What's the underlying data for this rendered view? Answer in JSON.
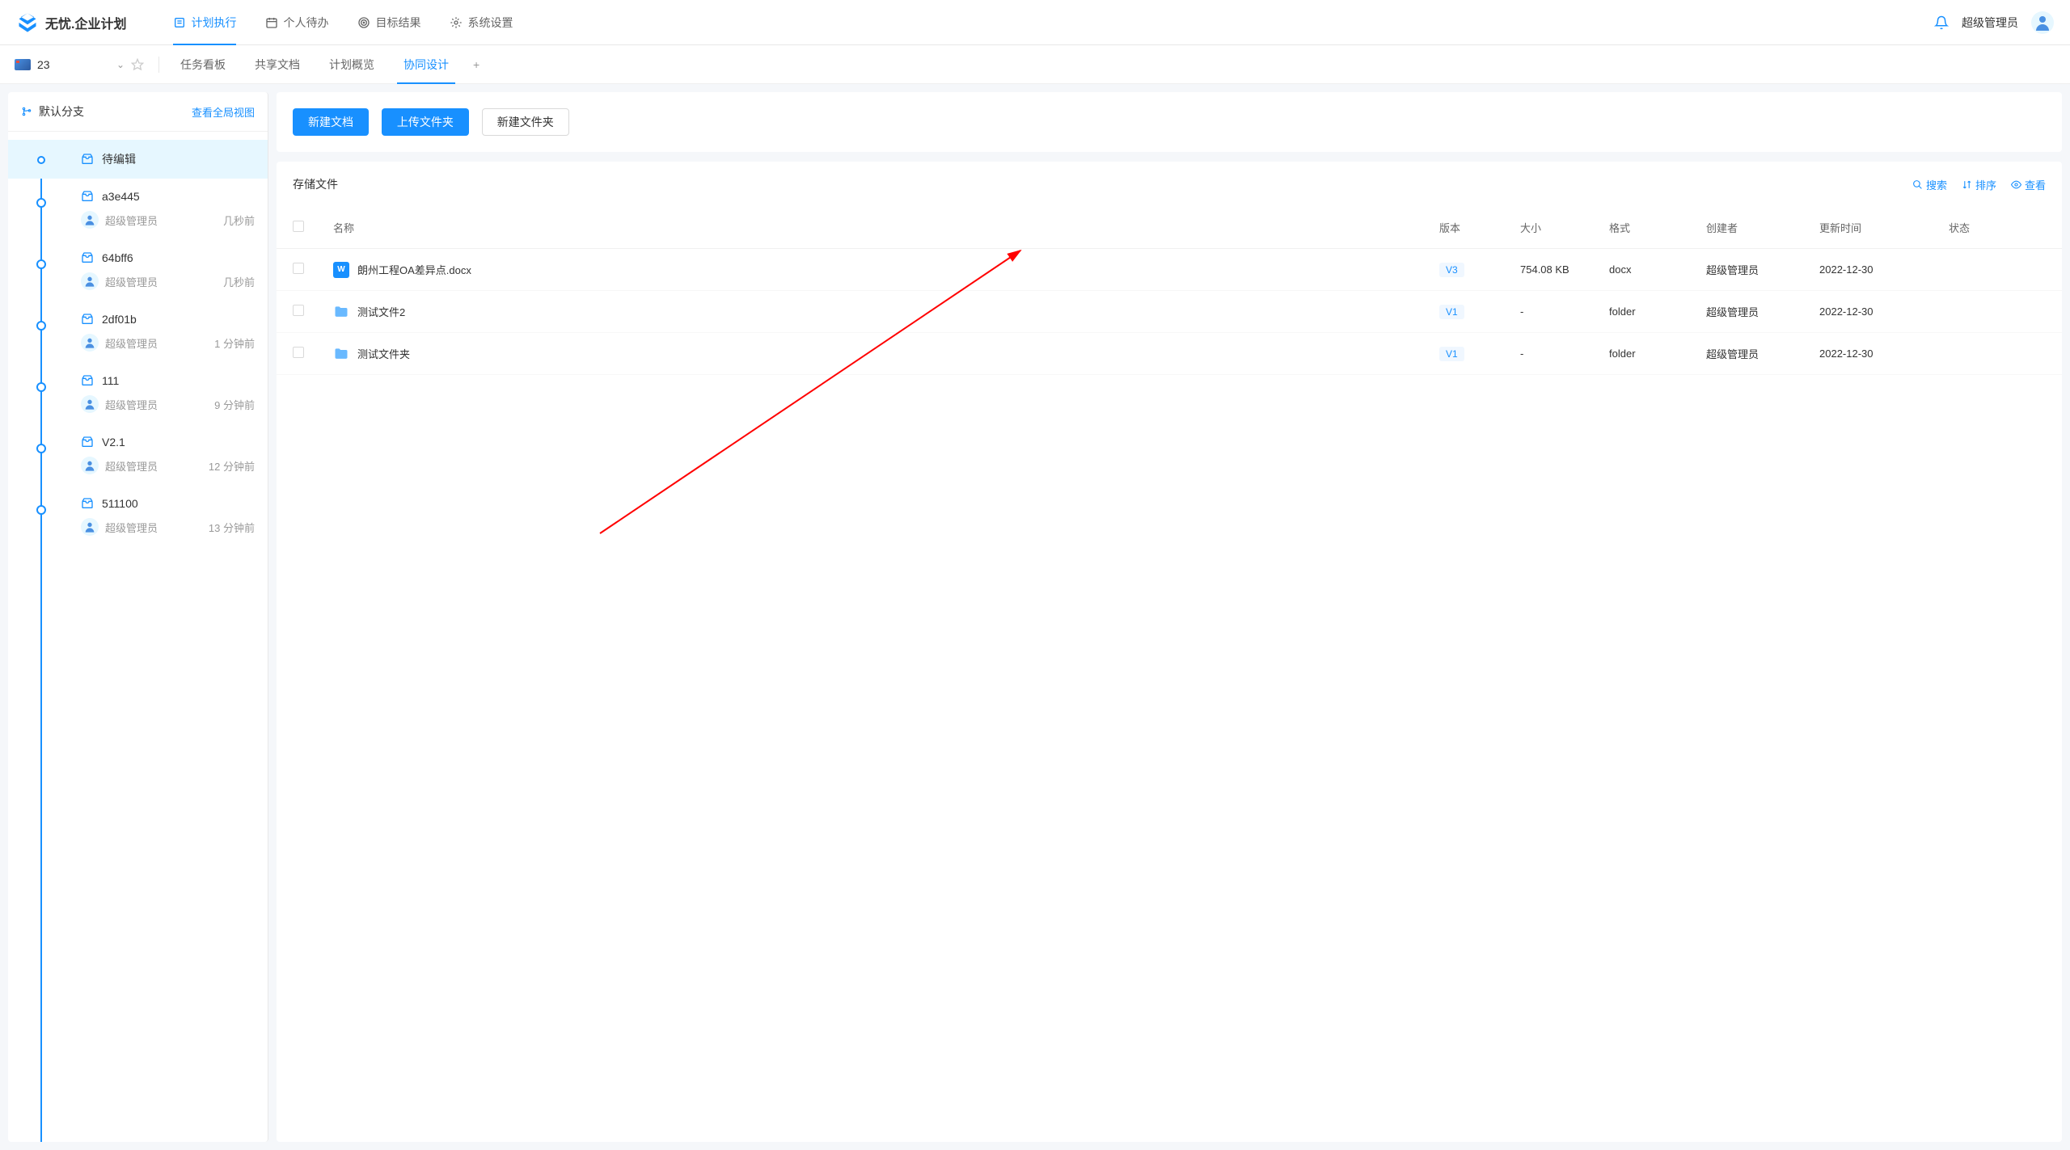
{
  "app": {
    "name": "无忧.企业计划"
  },
  "nav": [
    {
      "label": "计划执行",
      "icon": "plan",
      "active": true
    },
    {
      "label": "个人待办",
      "icon": "todo",
      "active": false
    },
    {
      "label": "目标结果",
      "icon": "target",
      "active": false
    },
    {
      "label": "系统设置",
      "icon": "settings",
      "active": false
    }
  ],
  "user": {
    "name": "超级管理员"
  },
  "project": {
    "name": "23"
  },
  "tabs": [
    {
      "label": "任务看板",
      "active": false
    },
    {
      "label": "共享文档",
      "active": false
    },
    {
      "label": "计划概览",
      "active": false
    },
    {
      "label": "协同设计",
      "active": true
    }
  ],
  "branch": {
    "name": "默认分支",
    "view_link": "查看全局视图"
  },
  "timeline": [
    {
      "title": "待编辑",
      "user": "",
      "time": "",
      "active": true,
      "first": true
    },
    {
      "title": "a3e445",
      "user": "超级管理员",
      "time": "几秒前"
    },
    {
      "title": "64bff6",
      "user": "超级管理员",
      "time": "几秒前"
    },
    {
      "title": "2df01b",
      "user": "超级管理员",
      "time": "1 分钟前"
    },
    {
      "title": "111",
      "user": "超级管理员",
      "time": "9 分钟前"
    },
    {
      "title": "V2.1",
      "user": "超级管理员",
      "time": "12 分钟前"
    },
    {
      "title": "511100",
      "user": "超级管理员",
      "time": "13 分钟前"
    }
  ],
  "actions": {
    "new_doc": "新建文档",
    "upload_folder": "上传文件夹",
    "new_folder": "新建文件夹"
  },
  "files_section": {
    "title": "存储文件",
    "tools": {
      "search": "搜索",
      "sort": "排序",
      "view": "查看"
    }
  },
  "table": {
    "headers": {
      "name": "名称",
      "version": "版本",
      "size": "大小",
      "format": "格式",
      "creator": "创建者",
      "updated": "更新时间",
      "status": "状态"
    },
    "rows": [
      {
        "name": "朗州工程OA差异点.docx",
        "type": "doc",
        "version": "V3",
        "size": "754.08 KB",
        "format": "docx",
        "creator": "超级管理员",
        "updated": "2022-12-30",
        "status": ""
      },
      {
        "name": "测试文件2",
        "type": "folder",
        "version": "V1",
        "size": "-",
        "format": "folder",
        "creator": "超级管理员",
        "updated": "2022-12-30",
        "status": ""
      },
      {
        "name": "测试文件夹",
        "type": "folder",
        "version": "V1",
        "size": "-",
        "format": "folder",
        "creator": "超级管理员",
        "updated": "2022-12-30",
        "status": ""
      }
    ]
  }
}
